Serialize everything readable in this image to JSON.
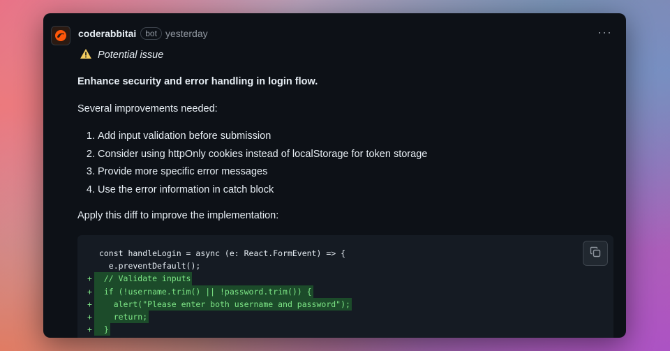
{
  "comment": {
    "author": "coderabbitai",
    "badge": "bot",
    "time": "yesterday",
    "more_icon": "kebab-horizontal-icon"
  },
  "issue": {
    "label": "Potential issue",
    "icon": "warning-icon",
    "icon_color": "#f2cc60"
  },
  "body": {
    "title": "Enhance security and error handling in login flow.",
    "intro": "Several improvements needed:",
    "items": [
      "Add input validation before submission",
      "Consider using httpOnly cookies instead of localStorage for token storage",
      "Provide more specific error messages",
      "Use the error information in catch block"
    ],
    "apply": "Apply this diff to improve the implementation:"
  },
  "code": {
    "copy_icon": "copy-icon",
    "lines": [
      {
        "marker": " ",
        "text": " const handleLogin = async (e: React.FormEvent) => {",
        "added": false
      },
      {
        "marker": " ",
        "text": "   e.preventDefault();",
        "added": false
      },
      {
        "marker": "+",
        "text": "  // Validate inputs",
        "added": true
      },
      {
        "marker": "+",
        "text": "  if (!username.trim() || !password.trim()) {",
        "added": true
      },
      {
        "marker": "+",
        "text": "    alert(\"Please enter both username and password\");",
        "added": true
      },
      {
        "marker": "+",
        "text": "    return;",
        "added": true
      },
      {
        "marker": "+",
        "text": "  }",
        "added": true
      }
    ]
  },
  "colors": {
    "background": "#0d1117",
    "code_background": "#151b23",
    "added_background": "#1c4b2a",
    "added_text": "#7ee787"
  }
}
